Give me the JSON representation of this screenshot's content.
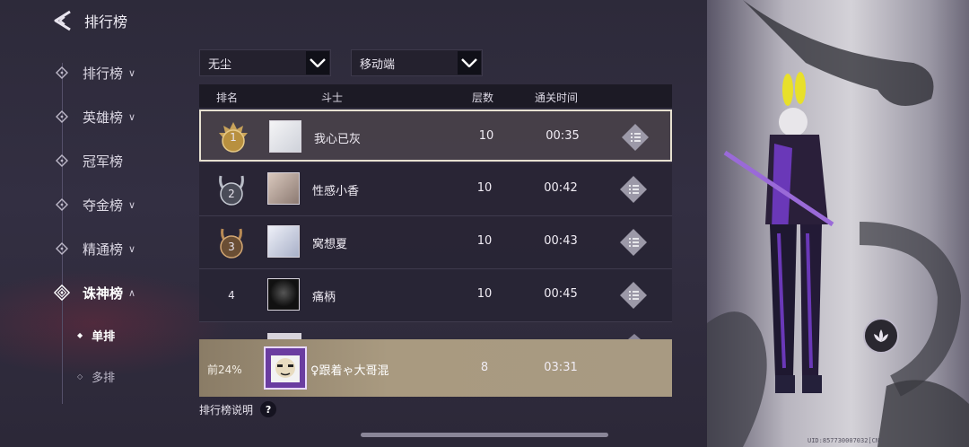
{
  "header": {
    "title": "排行榜"
  },
  "sidebar": {
    "items": [
      {
        "label": "排行榜",
        "chevron": "∨"
      },
      {
        "label": "英雄榜",
        "chevron": "∨"
      },
      {
        "label": "冠军榜",
        "chevron": ""
      },
      {
        "label": "夺金榜",
        "chevron": "∨"
      },
      {
        "label": "精通榜",
        "chevron": "∨"
      },
      {
        "label": "诛神榜",
        "chevron": "∧"
      }
    ],
    "sub_items": [
      {
        "label": "单排",
        "active": true
      },
      {
        "label": "多排",
        "active": false
      }
    ]
  },
  "filters": {
    "server": "无尘",
    "platform": "移动端"
  },
  "table": {
    "headers": {
      "rank": "排名",
      "player": "斗士",
      "floors": "层数",
      "time": "通关时间"
    },
    "rows": [
      {
        "rank": "1",
        "name": "我心已灰",
        "floors": "10",
        "time": "00:35"
      },
      {
        "rank": "2",
        "name": "性感小香",
        "floors": "10",
        "time": "00:42"
      },
      {
        "rank": "3",
        "name": "窝想夏",
        "floors": "10",
        "time": "00:43"
      },
      {
        "rank": "4",
        "name": "痛柄",
        "floors": "10",
        "time": "00:45"
      }
    ]
  },
  "my_rank": {
    "percent": "前24%",
    "name": "♀跟着ゃ大哥混",
    "floors": "8",
    "time": "03:31"
  },
  "footer": {
    "explain": "排行榜说明",
    "help": "?"
  },
  "uid_text": "UID:857730007032[CN]",
  "colors": {
    "gold": "#c9a35a",
    "silver": "#b8bcc6",
    "bronze": "#b88a55",
    "highlight_border": "#e6e0d0"
  }
}
